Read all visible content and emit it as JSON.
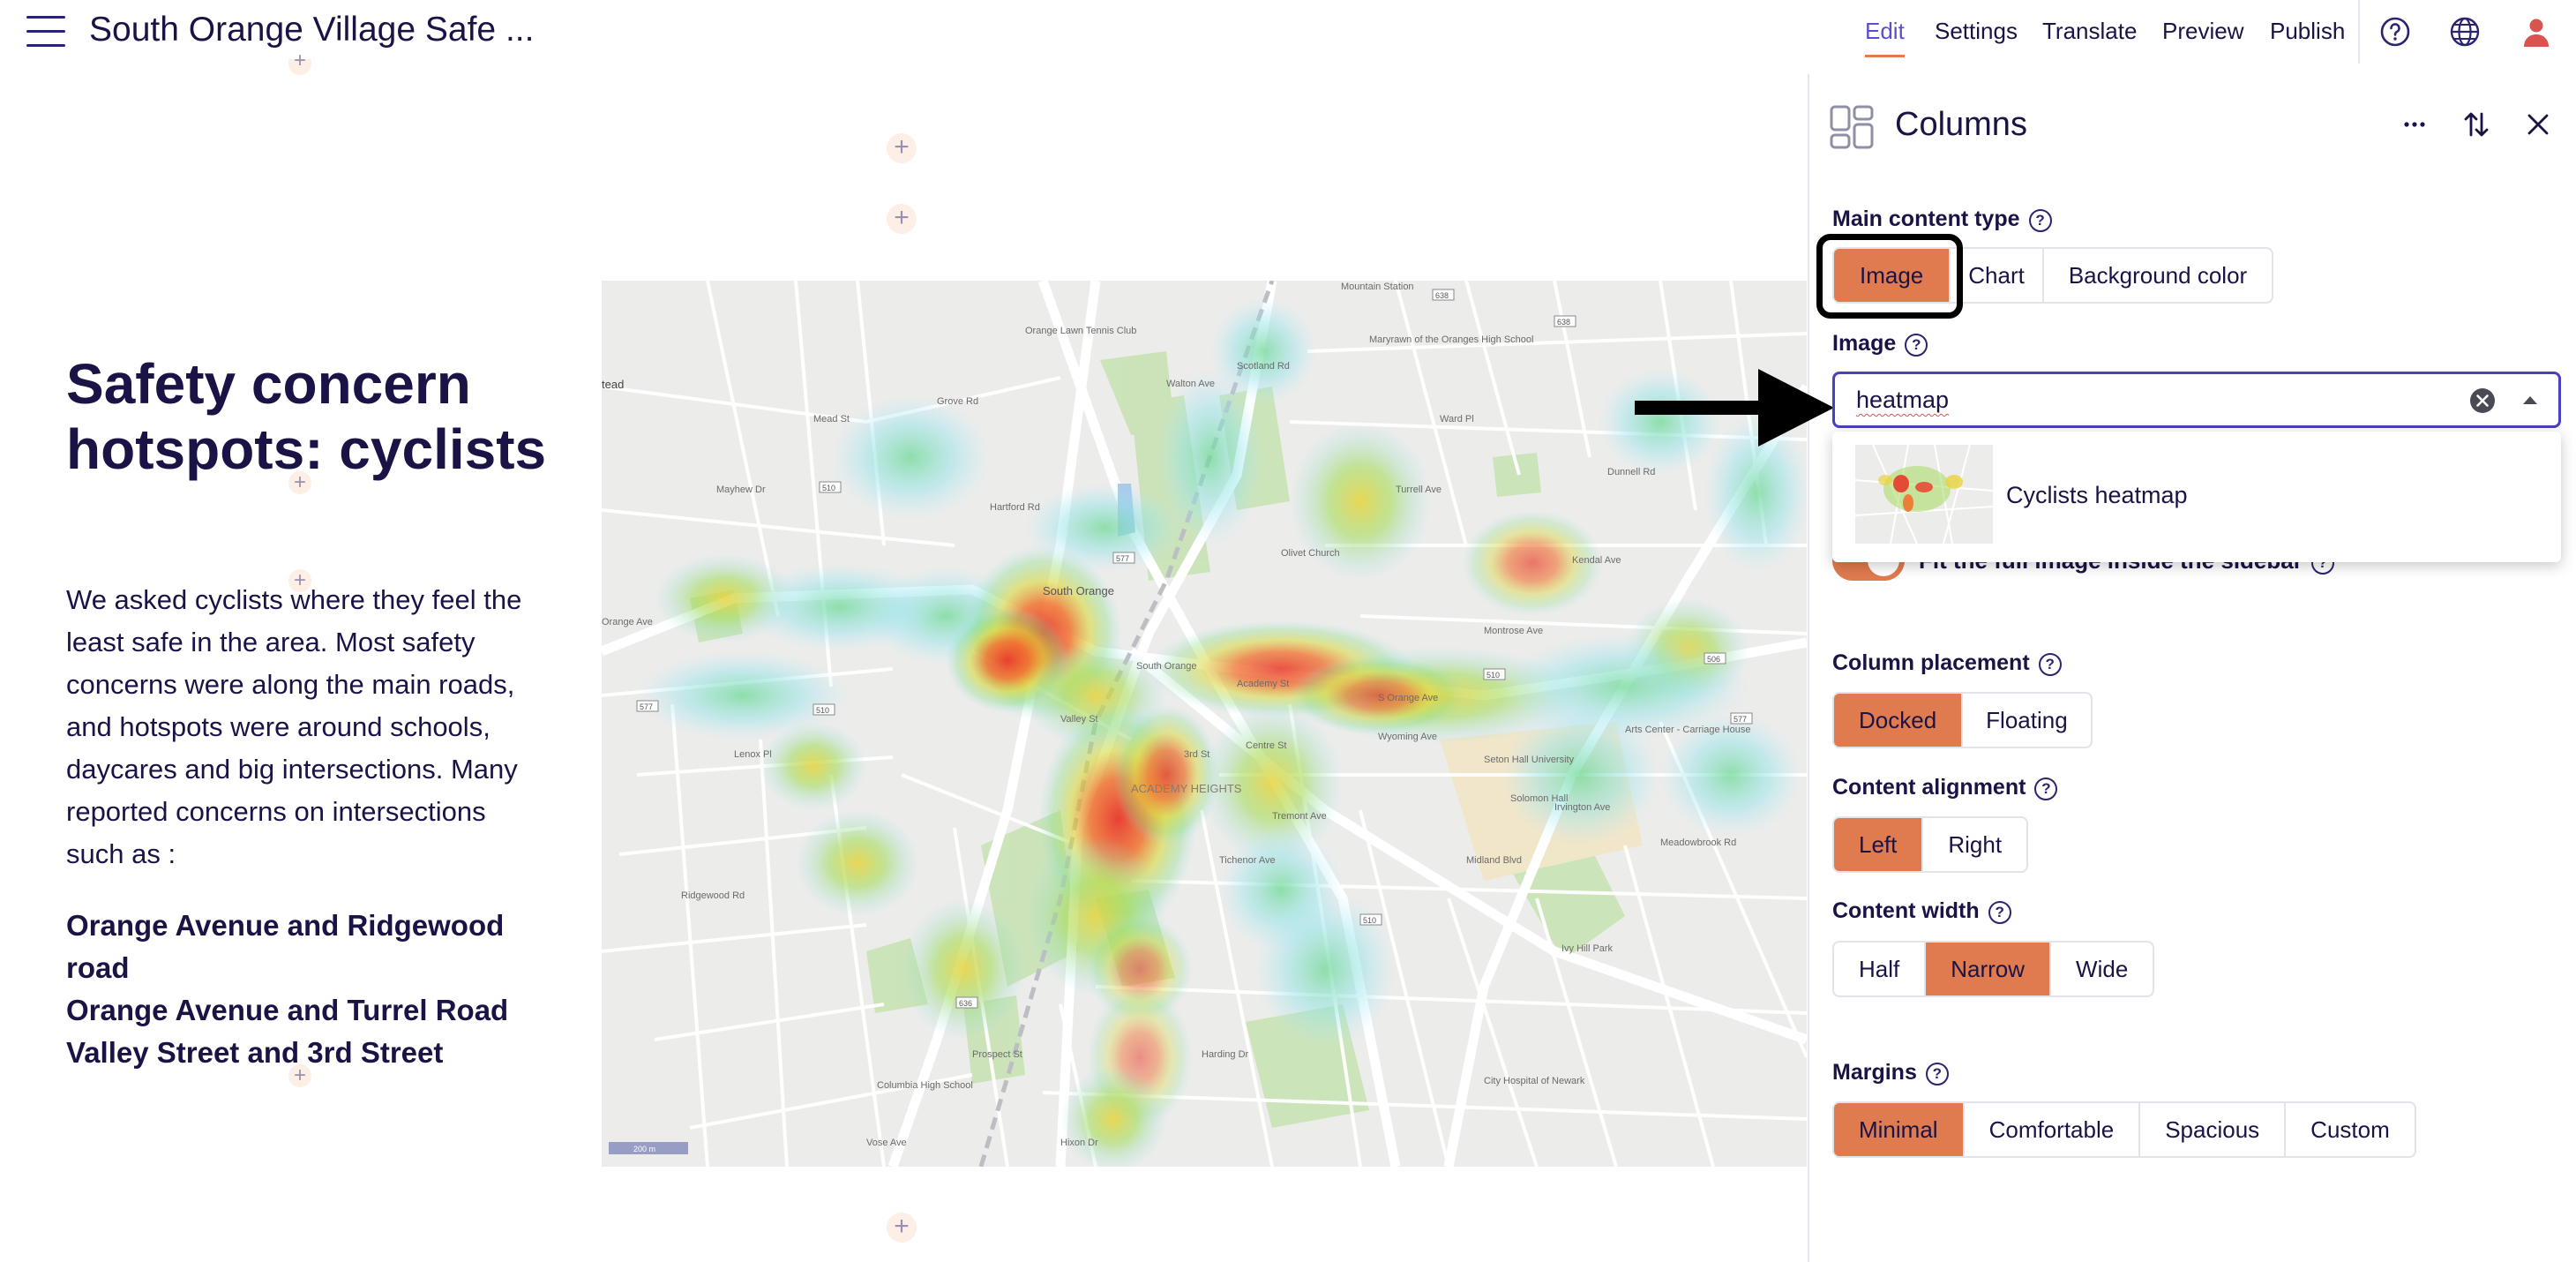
{
  "app": {
    "title": "South Orange Village Safe ..."
  },
  "topnav": {
    "edit": "Edit",
    "settings": "Settings",
    "translate": "Translate",
    "preview": "Preview",
    "publish": "Publish"
  },
  "story": {
    "headline": "Safety concern hotspots: cyclists",
    "body": "We asked cyclists where they feel the least safe in the area. Most safety concerns were along the main roads, and hotspots were around schools, daycares and big intersections. Many reported concerns on intersections such as :",
    "intersections": [
      "Orange Avenue and Ridgewood road",
      "Orange Avenue and Turrel Road",
      "Valley Street and 3rd Street"
    ]
  },
  "map": {
    "left_edge_label": "tead",
    "place_labels": [
      "South Orange",
      "Orange Lawn Tennis Club",
      "Mountain Station",
      "Maryrawn of the Oranges High School",
      "Olivet Church",
      "Arts Center - Carriage House",
      "Seton Hall University",
      "Solomon Hall",
      "Columbia High School",
      "Ivy Hill Park",
      "City Hospital of Newark",
      "ACADEMY HEIGHTS",
      "South Orange",
      "Orange Ave",
      "S Orange Ave",
      "Ridgewood Rd",
      "Valley St",
      "3rd St",
      "Turrell Ave",
      "Prospect St",
      "Scotland Rd",
      "Irvington Ave",
      "Wyoming Ave",
      "Meadowbrook Rd",
      "Tichenor Ave",
      "Montrose Ave",
      "Academy St",
      "Walton Ave",
      "Grove Rd",
      "Mead St",
      "Hartford Rd",
      "Mayhew Dr",
      "Centre St",
      "Tremont Ave",
      "Kendal Ave",
      "Lenox Pl",
      "Midland Blvd",
      "Harding Dr",
      "Hixon Dr",
      "Dunnell Rd",
      "Ward Pl",
      "Vose Ave"
    ],
    "shields": [
      "510",
      "577",
      "638",
      "636",
      "506",
      "510",
      "577",
      "510",
      "510",
      "577",
      "638"
    ],
    "scale_label": "200 m"
  },
  "sidebar": {
    "title": "Columns",
    "main_content_type": {
      "label": "Main content type",
      "options": [
        "Image",
        "Chart",
        "Background color"
      ],
      "selected": "Image"
    },
    "image": {
      "label": "Image",
      "search_value": "heatmap",
      "results": [
        {
          "label": "Cyclists heatmap",
          "thumb_icon": "heatmap-thumbnail"
        }
      ]
    },
    "fit_image_label": "Fit the full image inside the sidebar",
    "column_placement": {
      "label": "Column placement",
      "options": [
        "Docked",
        "Floating"
      ],
      "selected": "Docked"
    },
    "content_alignment": {
      "label": "Content alignment",
      "options": [
        "Left",
        "Right"
      ],
      "selected": "Left"
    },
    "content_width": {
      "label": "Content width",
      "options": [
        "Half",
        "Narrow",
        "Wide"
      ],
      "selected": "Narrow"
    },
    "margins": {
      "label": "Margins",
      "options": [
        "Minimal",
        "Comfortable",
        "Spacious",
        "Custom"
      ],
      "selected": "Minimal"
    }
  },
  "colors": {
    "accent": "#e07a4f",
    "text": "#1a1446",
    "link_active": "#5a4fcf",
    "search_border": "#4a3fbf",
    "user_icon": "#d9534f"
  },
  "icons": {
    "menu": "hamburger-menu-icon",
    "help": "question-circle-icon",
    "language": "globe-icon",
    "user": "user-icon",
    "columns": "columns-layout-icon",
    "more": "ellipsis-icon",
    "swap": "swap-vertical-icon",
    "close": "close-icon",
    "clear": "clear-circle-icon",
    "caret": "caret-up-icon",
    "arrow": "pointer-arrow-icon"
  }
}
